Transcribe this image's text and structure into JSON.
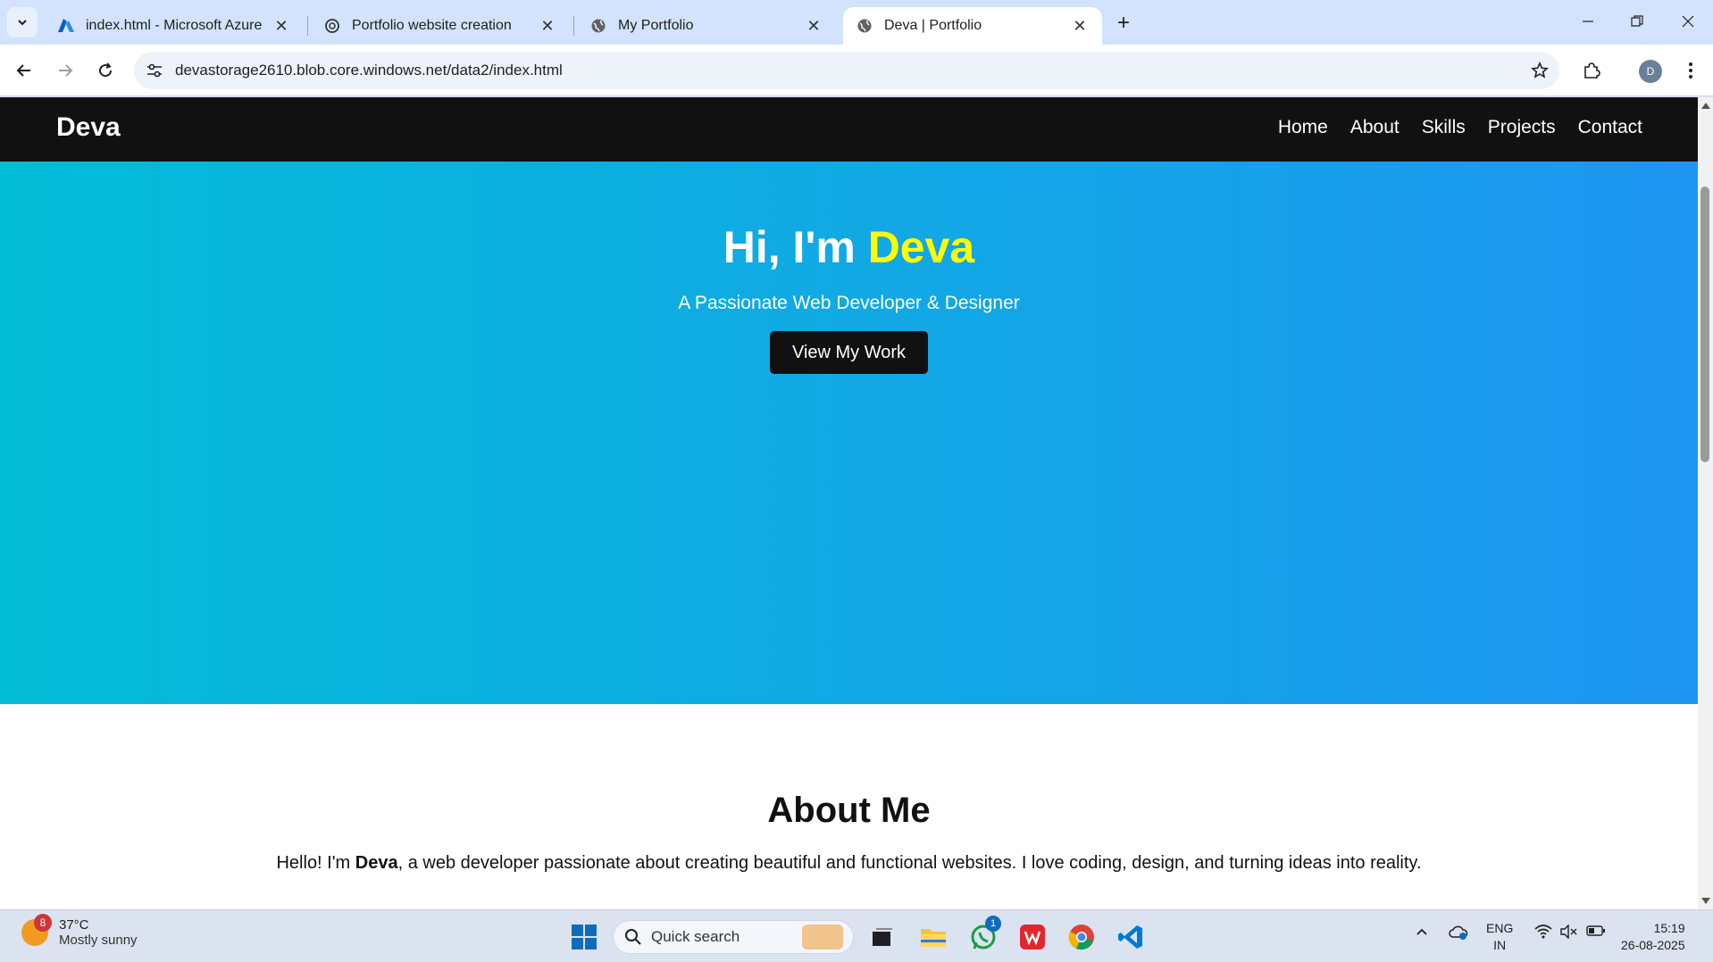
{
  "browser": {
    "tabs": [
      {
        "title": "index.html - Microsoft Azure",
        "icon": "azure-icon"
      },
      {
        "title": "Portfolio website creation",
        "icon": "chatgpt-icon"
      },
      {
        "title": "My Portfolio",
        "icon": "globe-icon"
      },
      {
        "title": "Deva | Portfolio",
        "icon": "globe-icon"
      }
    ],
    "active_tab": 3,
    "url": "devastorage2610.blob.core.windows.net/data2/index.html",
    "profile_initial": "D"
  },
  "site": {
    "brand": "Deva",
    "nav": [
      "Home",
      "About",
      "Skills",
      "Projects",
      "Contact"
    ],
    "hero": {
      "greeting": "Hi, I'm ",
      "name": "Deva",
      "tagline": "A Passionate Web Developer & Designer",
      "cta": "View My Work"
    },
    "about": {
      "heading": "About Me",
      "text_before": "Hello! I'm ",
      "text_bold": "Deva",
      "text_after": ", a web developer passionate about creating beautiful and functional websites. I love coding, design, and turning ideas into reality."
    },
    "colors": {
      "hero_start": "#03bcd6",
      "hero_end": "#1e96f2",
      "highlight": "#ffff00",
      "nav_bg": "#111111"
    }
  },
  "taskbar": {
    "weather": {
      "badge": "8",
      "temp": "37°C",
      "condition": "Mostly sunny"
    },
    "search_label": "Quick search",
    "whatsapp_badge": "1",
    "language": {
      "line1": "ENG",
      "line2": "IN"
    },
    "clock": {
      "time": "15:19",
      "date": "26-08-2025"
    }
  }
}
